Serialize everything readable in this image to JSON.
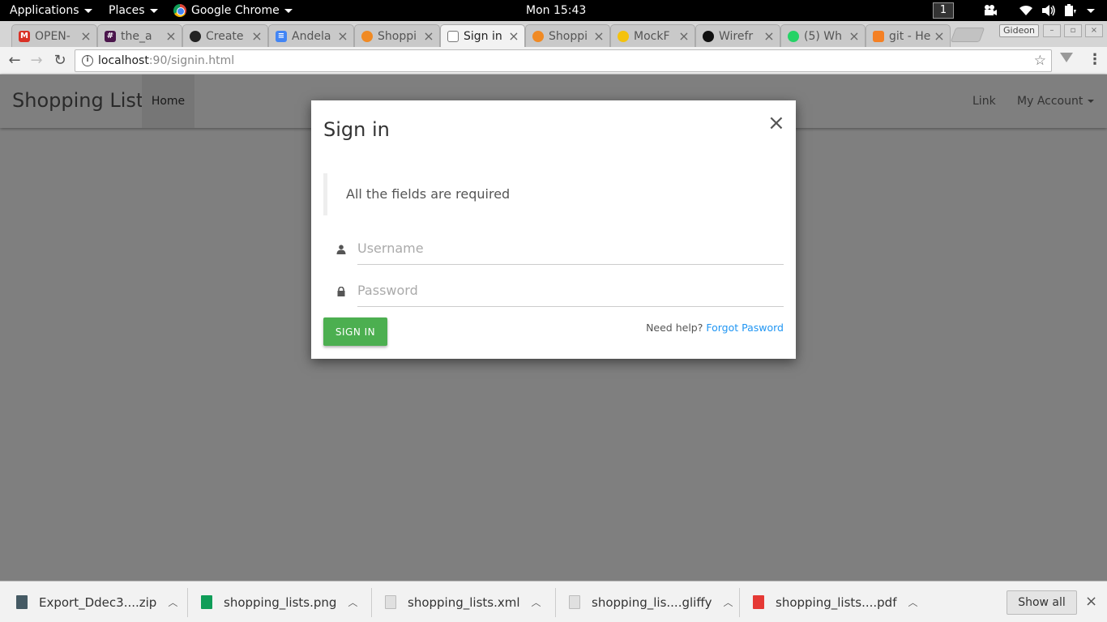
{
  "topbar": {
    "applications": "Applications",
    "places": "Places",
    "app_name": "Google Chrome",
    "clock": "Mon 15:43",
    "workspace": "1"
  },
  "tabs": [
    {
      "label": "OPEN-",
      "icon": "gmail-icon",
      "color": "#d93025"
    },
    {
      "label": "the_a",
      "icon": "slack-icon",
      "color": "#4a154b"
    },
    {
      "label": "Create",
      "icon": "github-icon",
      "color": "#222222"
    },
    {
      "label": "Andela",
      "icon": "google-docs-icon",
      "color": "#4285f4"
    },
    {
      "label": "Shoppi",
      "icon": "shopping-icon",
      "color": "#f08a24"
    },
    {
      "label": "Sign in",
      "icon": "page-icon",
      "color": "#777777"
    },
    {
      "label": "Shoppi",
      "icon": "shopping-icon",
      "color": "#f08a24"
    },
    {
      "label": "MockF",
      "icon": "mockflow-icon",
      "color": "#f4c20d"
    },
    {
      "label": "Wirefr",
      "icon": "wireframe-icon",
      "color": "#111111"
    },
    {
      "label": "(5) Wh",
      "icon": "whatsapp-icon",
      "color": "#25d366"
    },
    {
      "label": "git - He",
      "icon": "stackoverflow-icon",
      "color": "#f48024"
    }
  ],
  "profile": "Gideon",
  "address": {
    "host": "localhost",
    "path": ":90/signin.html"
  },
  "site": {
    "brand": "Shopping List",
    "home": "Home",
    "link": "Link",
    "account": "My Account"
  },
  "modal": {
    "title": "Sign in",
    "notice": "All the fields are required",
    "username_placeholder": "Username",
    "password_placeholder": "Password",
    "submit": "SIGN IN",
    "help_text": "Need help?",
    "forgot": "Forgot Pasword"
  },
  "downloads": [
    {
      "name": "Export_Ddec3....zip",
      "icon": "archive-file-icon",
      "color": "#455a64"
    },
    {
      "name": "shopping_lists.png",
      "icon": "image-file-icon",
      "color": "#0f9d58"
    },
    {
      "name": "shopping_lists.xml",
      "icon": "xml-file-icon",
      "color": "#9e9e9e"
    },
    {
      "name": "shopping_lis....gliffy",
      "icon": "generic-file-icon",
      "color": "#9e9e9e"
    },
    {
      "name": "shopping_lists....pdf",
      "icon": "pdf-file-icon",
      "color": "#e53935"
    }
  ],
  "show_all": "Show all",
  "colors": {
    "accent_green": "#4caf50",
    "link_blue": "#2196f3"
  }
}
